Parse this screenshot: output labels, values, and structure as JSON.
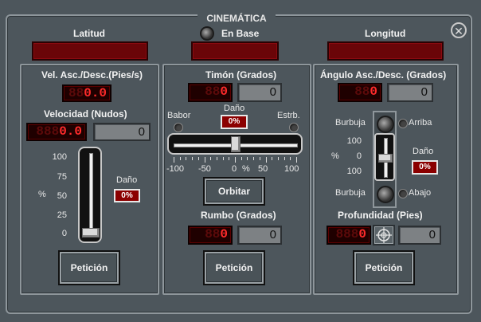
{
  "title": "CINEMÁTICA",
  "close_icon": "close-x-circle-icon",
  "header": {
    "latitud_label": "Latitud",
    "en_base_label": "En Base",
    "longitud_label": "Longitud"
  },
  "left": {
    "vel_asc_label": "Vel. Asc./Desc.(Pies/s)",
    "vel_asc_led": {
      "ghost": "88",
      "value": "0.0"
    },
    "velocidad_label": "Velocidad (Nudos)",
    "velocidad_led": {
      "ghost": "888",
      "value": "0.0"
    },
    "velocidad_input": "0",
    "scale": [
      "100",
      "75",
      "50",
      "25",
      "0"
    ],
    "percent_label": "%",
    "dano_label": "Daño",
    "dano_value": "0%",
    "slider_level": 0,
    "peticion_label": "Petición"
  },
  "center": {
    "timon_label": "Timón (Grados)",
    "timon_led": {
      "ghost": "88",
      "value": "0"
    },
    "timon_input": "0",
    "babor_label": "Babor",
    "dano_label": "Daño",
    "dano_value": "0%",
    "estrb_label": "Estrb.",
    "scale": [
      "-100",
      "-50",
      "0",
      "50",
      "100"
    ],
    "percent_label": "%",
    "slider_value": 0,
    "orbitar_label": "Orbitar",
    "rumbo_label": "Rumbo (Grados)",
    "rumbo_led": {
      "ghost": "88",
      "value": "0"
    },
    "rumbo_input": "0",
    "peticion_label": "Petición"
  },
  "right": {
    "angulo_label": "Ángulo Asc./Desc.  (Grados)",
    "angulo_led": {
      "ghost": "88",
      "value": "0"
    },
    "angulo_input": "0",
    "burbuja_top_label": "Burbuja",
    "arriba_label": "Arriba",
    "scale": [
      "100",
      "0",
      "100"
    ],
    "percent_label": "%",
    "dano_label": "Daño",
    "dano_value": "0%",
    "burbuja_bottom_label": "Burbuja",
    "abajo_label": "Abajo",
    "profundidad_label": "Profundidad  (Pies)",
    "profundidad_led": {
      "ghost": "888",
      "value": "0"
    },
    "profundidad_input": "0",
    "target_icon": "crosshair-icon",
    "peticion_label": "Petición"
  },
  "colors": {
    "led_on": "#ff2b2b",
    "led_bg": "#1f0000",
    "damage_bg": "#8b0000",
    "panel_bg": "#4d565c"
  }
}
